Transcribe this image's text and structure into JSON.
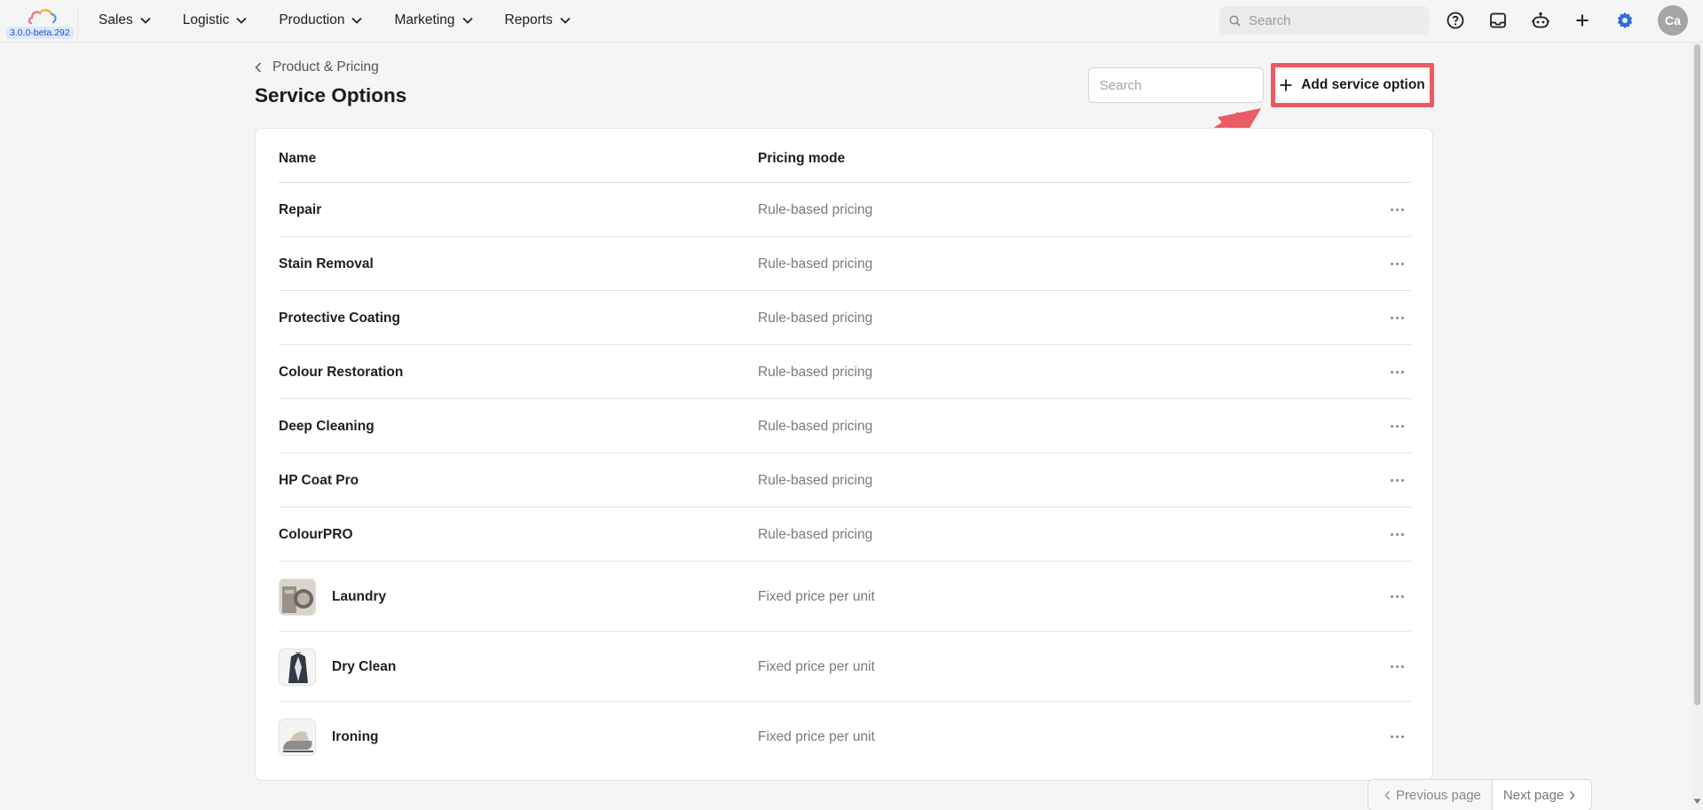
{
  "app": {
    "version": "3.0.0-beta.292",
    "brand_colors": [
      "#f26a8d",
      "#f9b233",
      "#4aa3df"
    ]
  },
  "nav": {
    "items": [
      {
        "label": "Sales"
      },
      {
        "label": "Logistic"
      },
      {
        "label": "Production"
      },
      {
        "label": "Marketing"
      },
      {
        "label": "Reports"
      }
    ]
  },
  "top_search": {
    "placeholder": "Search"
  },
  "top_icons": [
    "help-icon",
    "inbox-icon",
    "robot-icon",
    "plus-icon",
    "gear-icon"
  ],
  "user": {
    "initials": "Ca"
  },
  "header": {
    "breadcrumb": "Product & Pricing",
    "title": "Service Options",
    "search_placeholder": "Search",
    "add_button_label": "Add service option",
    "highlight_color": "#ea5b66"
  },
  "table": {
    "columns": {
      "name": "Name",
      "pricing_mode": "Pricing mode"
    },
    "rows": [
      {
        "name": "Repair",
        "pricing_mode": "Rule-based pricing",
        "thumbnail": ""
      },
      {
        "name": "Stain Removal",
        "pricing_mode": "Rule-based pricing",
        "thumbnail": ""
      },
      {
        "name": "Protective Coating",
        "pricing_mode": "Rule-based pricing",
        "thumbnail": ""
      },
      {
        "name": "Colour Restoration",
        "pricing_mode": "Rule-based pricing",
        "thumbnail": ""
      },
      {
        "name": "Deep Cleaning",
        "pricing_mode": "Rule-based pricing",
        "thumbnail": ""
      },
      {
        "name": "HP Coat Pro",
        "pricing_mode": "Rule-based pricing",
        "thumbnail": ""
      },
      {
        "name": "ColourPRO",
        "pricing_mode": "Rule-based pricing",
        "thumbnail": ""
      },
      {
        "name": "Laundry",
        "pricing_mode": "Fixed price per unit",
        "thumbnail": "laundry-image"
      },
      {
        "name": "Dry Clean",
        "pricing_mode": "Fixed price per unit",
        "thumbnail": "suit-image"
      },
      {
        "name": "Ironing",
        "pricing_mode": "Fixed price per unit",
        "thumbnail": "iron-image"
      }
    ]
  },
  "pagination": {
    "previous_label": "Previous page",
    "next_label": "Next page"
  }
}
